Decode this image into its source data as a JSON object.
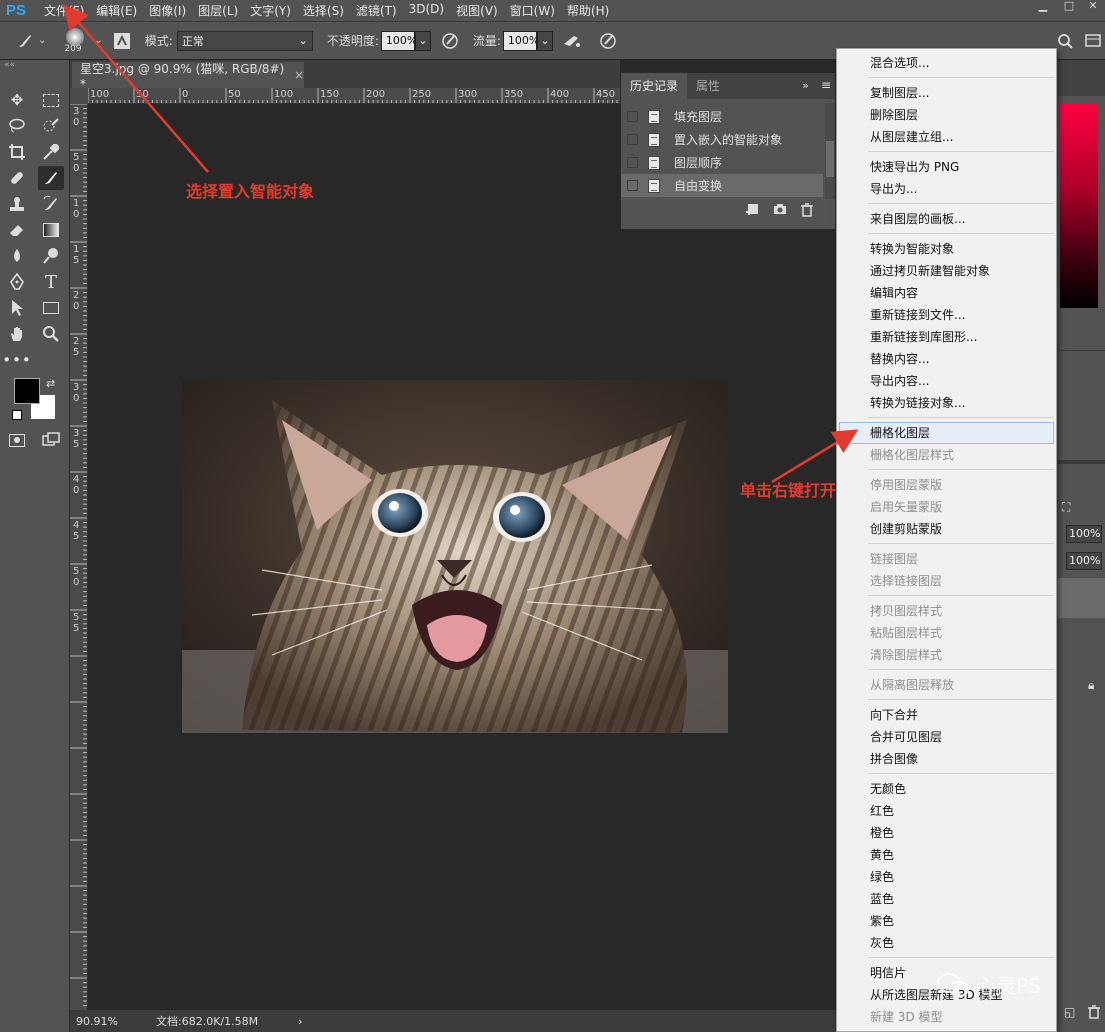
{
  "app": {
    "logo": "PS"
  },
  "menubar": {
    "items": [
      "文件(F)",
      "编辑(E)",
      "图像(I)",
      "图层(L)",
      "文字(Y)",
      "选择(S)",
      "滤镜(T)",
      "3D(D)",
      "视图(V)",
      "窗口(W)",
      "帮助(H)"
    ]
  },
  "options": {
    "brush_size": "209",
    "mode_label": "模式:",
    "mode_value": "正常",
    "opacity_label": "不透明度:",
    "opacity_value": "100%",
    "flow_label": "流量:",
    "flow_value": "100%"
  },
  "document": {
    "tab_title": "星空3.jpg @ 90.9% (猫咪, RGB/8#) *",
    "close": "×"
  },
  "ruler": {
    "top_labels": [
      "100",
      "50",
      "0",
      "50",
      "100",
      "150",
      "200",
      "250",
      "300",
      "350",
      "400",
      "450"
    ],
    "left_labels": [
      "3",
      "0",
      "5",
      "0",
      "1",
      "0",
      "1",
      "5",
      "2",
      "0",
      "2",
      "5",
      "3",
      "0",
      "3",
      "5",
      "4",
      "0",
      "4",
      "5",
      "5",
      "0",
      "5",
      "5"
    ]
  },
  "status": {
    "zoom": "90.91%",
    "doc_info": "文档:682.0K/1.58M",
    "arrow": "›"
  },
  "history": {
    "tabs": [
      "历史记录",
      "属性"
    ],
    "items": [
      "填充图层",
      "置入嵌入的智能对象",
      "图层顺序",
      "自由变换"
    ],
    "selected_index": 3
  },
  "context_menu": {
    "groups": [
      [
        {
          "label": "混合选项...",
          "enabled": true
        }
      ],
      [
        {
          "label": "复制图层...",
          "enabled": true
        },
        {
          "label": "删除图层",
          "enabled": true
        },
        {
          "label": "从图层建立组...",
          "enabled": true
        }
      ],
      [
        {
          "label": "快速导出为 PNG",
          "enabled": true
        },
        {
          "label": "导出为...",
          "enabled": true
        }
      ],
      [
        {
          "label": "来自图层的画板...",
          "enabled": true
        }
      ],
      [
        {
          "label": "转换为智能对象",
          "enabled": true
        },
        {
          "label": "通过拷贝新建智能对象",
          "enabled": true
        },
        {
          "label": "编辑内容",
          "enabled": true
        },
        {
          "label": "重新链接到文件...",
          "enabled": true
        },
        {
          "label": "重新链接到库图形...",
          "enabled": true
        },
        {
          "label": "替换内容...",
          "enabled": true
        },
        {
          "label": "导出内容...",
          "enabled": true
        },
        {
          "label": "转换为链接对象...",
          "enabled": true
        }
      ],
      [
        {
          "label": "栅格化图层",
          "enabled": true,
          "hover": true
        },
        {
          "label": "栅格化图层样式",
          "enabled": false
        }
      ],
      [
        {
          "label": "停用图层蒙版",
          "enabled": false
        },
        {
          "label": "启用矢量蒙版",
          "enabled": false
        },
        {
          "label": "创建剪贴蒙版",
          "enabled": true
        }
      ],
      [
        {
          "label": "链接图层",
          "enabled": false
        },
        {
          "label": "选择链接图层",
          "enabled": false
        }
      ],
      [
        {
          "label": "拷贝图层样式",
          "enabled": false
        },
        {
          "label": "粘贴图层样式",
          "enabled": false
        },
        {
          "label": "清除图层样式",
          "enabled": false
        }
      ],
      [
        {
          "label": "从隔离图层释放",
          "enabled": false
        }
      ],
      [
        {
          "label": "向下合并",
          "enabled": true
        },
        {
          "label": "合并可见图层",
          "enabled": true
        },
        {
          "label": "拼合图像",
          "enabled": true
        }
      ],
      [
        {
          "label": "无颜色",
          "enabled": true
        },
        {
          "label": "红色",
          "enabled": true
        },
        {
          "label": "橙色",
          "enabled": true
        },
        {
          "label": "黄色",
          "enabled": true
        },
        {
          "label": "绿色",
          "enabled": true
        },
        {
          "label": "蓝色",
          "enabled": true
        },
        {
          "label": "紫色",
          "enabled": true
        },
        {
          "label": "灰色",
          "enabled": true
        }
      ],
      [
        {
          "label": "明信片",
          "enabled": true
        },
        {
          "label": "从所选图层新建 3D 模型",
          "enabled": true
        },
        {
          "label": "新建 3D 模型",
          "enabled": false
        }
      ]
    ]
  },
  "right_panel": {
    "opacity_value": "100%",
    "fill_value": "100%"
  },
  "annotations": {
    "top": "选择置入智能对象",
    "right": "单击右键打开"
  },
  "watermark": "心灵PS",
  "colors": {
    "accent_red": "#e23b2e",
    "ps_blue": "#31a8ff"
  }
}
